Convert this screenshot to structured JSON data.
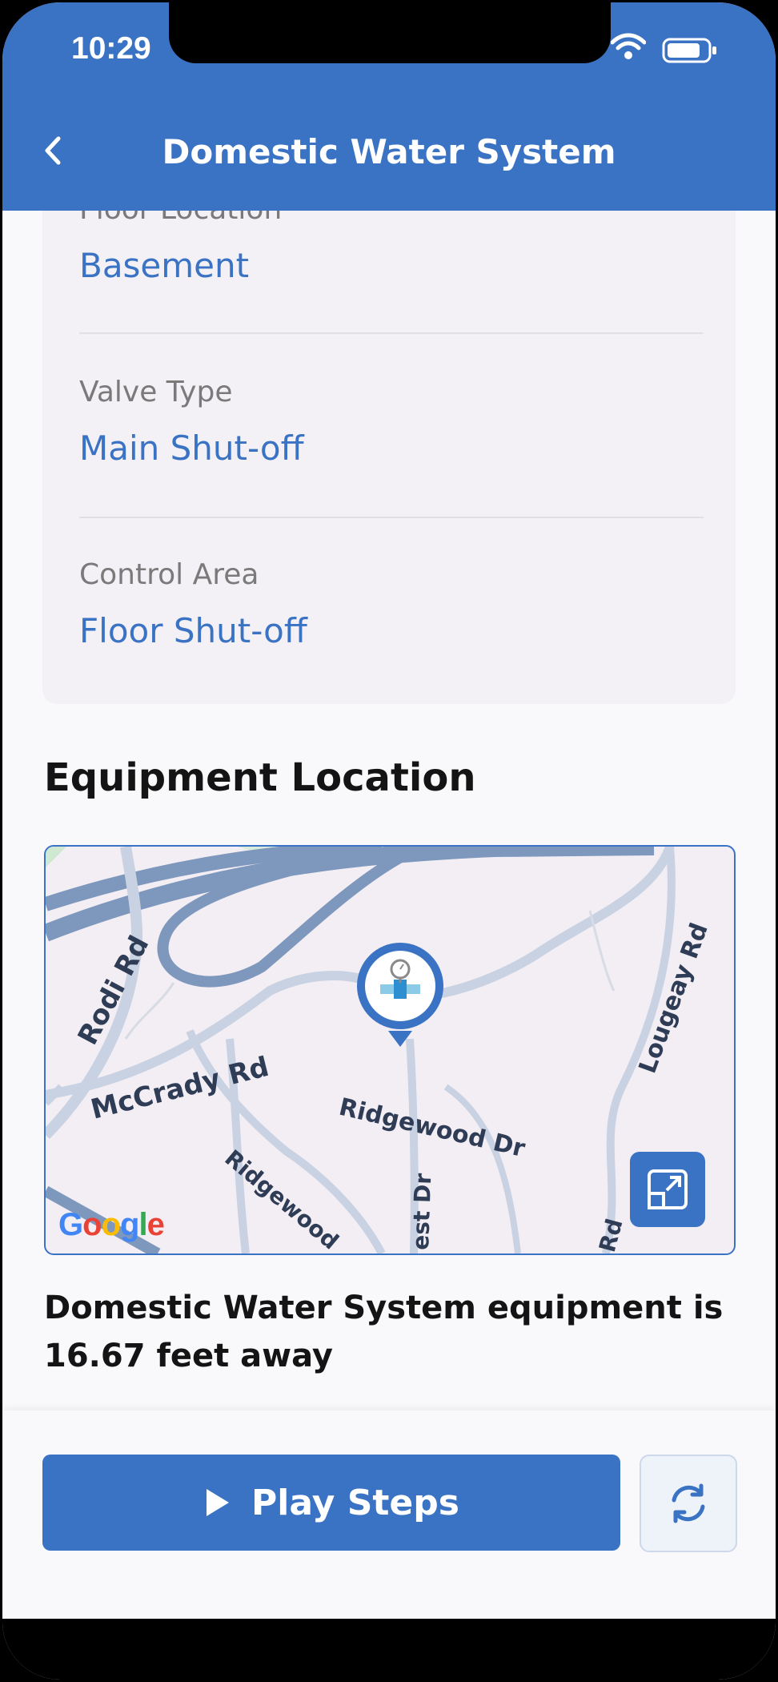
{
  "status_bar": {
    "time": "10:29"
  },
  "header": {
    "title": "Domestic Water System",
    "back_icon": "chevron-left-icon"
  },
  "details": {
    "fields": [
      {
        "label": "Floor Location",
        "value": "Basement"
      },
      {
        "label": "Valve Type",
        "value": "Main Shut-off"
      },
      {
        "label": "Control Area",
        "value": "Floor Shut-off"
      }
    ]
  },
  "equipment_location": {
    "title": "Equipment Location",
    "map": {
      "roads": [
        "Rodi Rd",
        "McCrady Rd",
        "Ridgewood Dr",
        "Lougeay Rd",
        "Ridgewood",
        "est Dr",
        "Rd"
      ],
      "logo": "Google",
      "expand_icon": "expand-icon",
      "marker_icon": "valve-marker-icon"
    },
    "distance_text": "Domestic Water System equipment is 16.67 feet away"
  },
  "footer": {
    "play_label": "Play Steps",
    "play_icon": "play-icon",
    "refresh_icon": "refresh-icon"
  },
  "colors": {
    "primary": "#3a72c4",
    "label_gray": "#7a7a7a"
  }
}
